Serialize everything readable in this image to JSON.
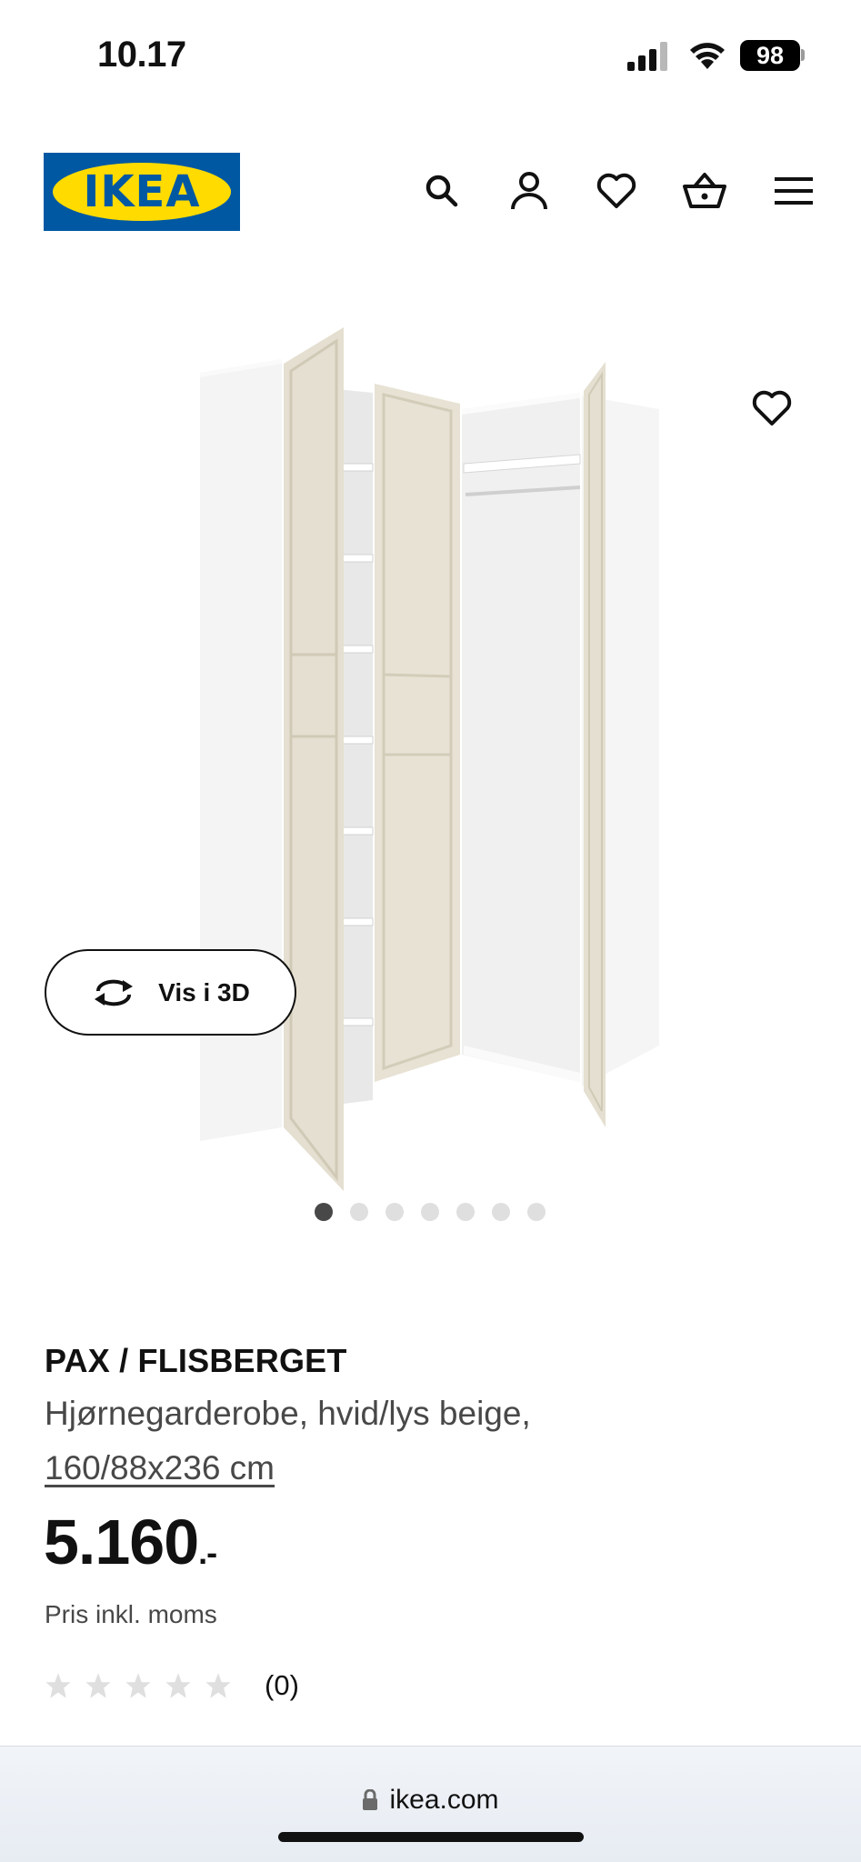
{
  "status_bar": {
    "time": "10.17",
    "battery": "98",
    "icons": [
      "signal-icon",
      "wifi-icon",
      "battery-icon"
    ]
  },
  "header": {
    "logo_text": "IKEA",
    "icons": [
      "search-icon",
      "account-icon",
      "heart-icon",
      "basket-icon",
      "menu-icon"
    ]
  },
  "gallery": {
    "view_3d_label": "Vis i 3D",
    "dot_count": 7,
    "active_dot": 1
  },
  "product": {
    "name": "PAX / FLISBERGET",
    "description": "Hjørnegarderobe, hvid/lys beige,",
    "size": "160/88x236 cm",
    "price": "5.160",
    "price_suffix": ".-",
    "price_note": "Pris inkl. moms",
    "rating_stars": 0,
    "rating_max": 5,
    "rating_count": "(0)"
  },
  "browser": {
    "url": "ikea.com",
    "lock_icon": "lock-icon"
  },
  "colors": {
    "brand_blue": "#0058a3",
    "brand_yellow": "#ffdb00",
    "text": "#111111",
    "muted_text": "#484848",
    "star_empty": "#dfdfdf",
    "dot_active": "#484848",
    "dot_inactive": "#dfdfdf"
  }
}
